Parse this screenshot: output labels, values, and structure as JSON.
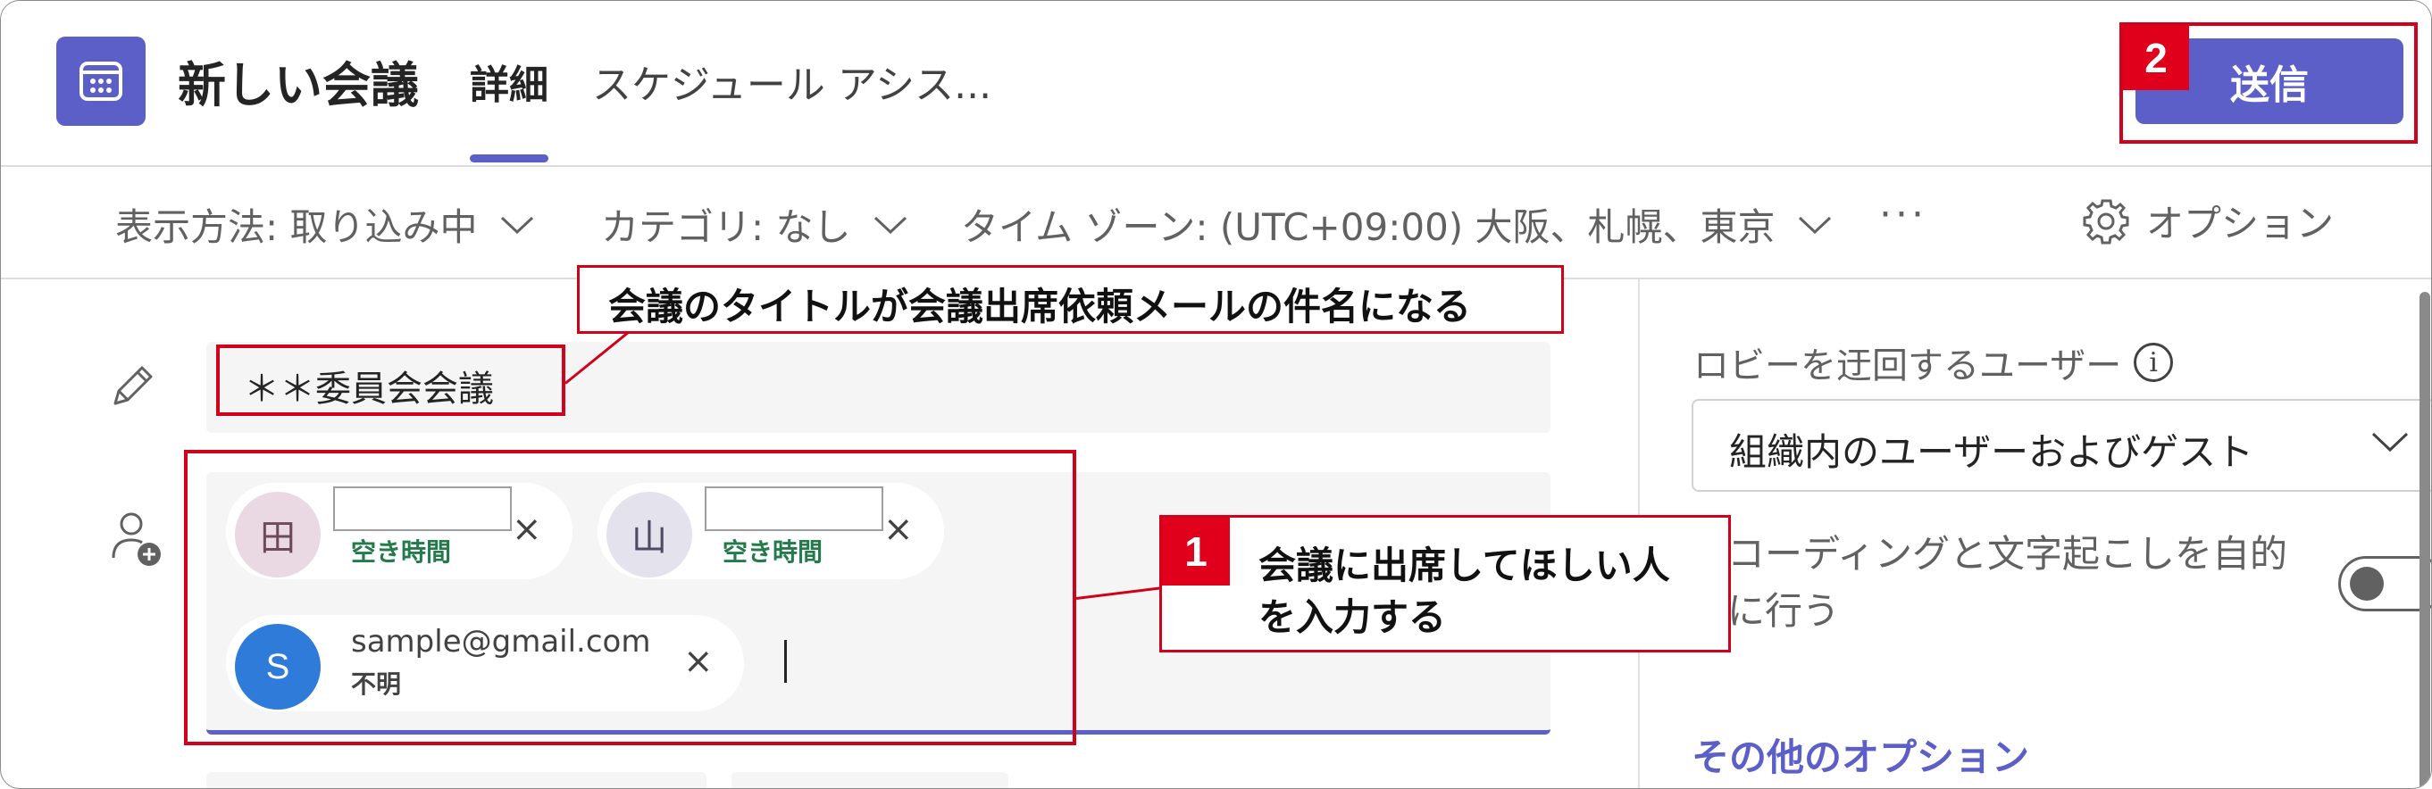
{
  "header": {
    "title": "新しい会議",
    "tabs": [
      {
        "label": "詳細",
        "active": true
      },
      {
        "label": "スケジュール アシス..."
      }
    ],
    "send_label": "送信",
    "app_icon": "calendar-icon"
  },
  "toolbar": {
    "show_as": "表示方法: 取り込み中",
    "category": "カテゴリ: なし",
    "timezone": "タイム ゾーン: (UTC+09:00) 大阪、札幌、東京",
    "more": "···",
    "options_label": "オプション"
  },
  "form": {
    "title_value": "＊＊委員会会議",
    "attendees": [
      {
        "avatar": "田",
        "name": "",
        "status": "空き時間",
        "avatar_bg": "#ead9e3",
        "avatar_fg": "#6b4a5c"
      },
      {
        "avatar": "山",
        "name": "",
        "status": "空き時間",
        "avatar_bg": "#e4e2ec",
        "avatar_fg": "#4e4a63"
      },
      {
        "avatar": "S",
        "name": "sample@gmail.com",
        "status": "不明",
        "avatar_bg": "#2f7bd9",
        "avatar_fg": "#ffffff"
      }
    ],
    "remove_glyph": "×"
  },
  "right_panel": {
    "lobby_label": "ロビーを迂回するユーザー",
    "lobby_value": "組織内のユーザーおよびゲスト",
    "record_label": "コーディングと文字起こしを自的に行う",
    "record_on": false,
    "more_options": "その他のオプション"
  },
  "annotations": {
    "title_note": "会議のタイトルが会議出席依頼メールの件名になる",
    "attendee_note_line1": "会議に出席してほしい人",
    "attendee_note_line2": "を入力する",
    "badge1": "1",
    "badge2": "2"
  },
  "colors": {
    "accent": "#5b5fc7",
    "annotation_red": "#d0021b",
    "available_green": "#237b4b"
  }
}
